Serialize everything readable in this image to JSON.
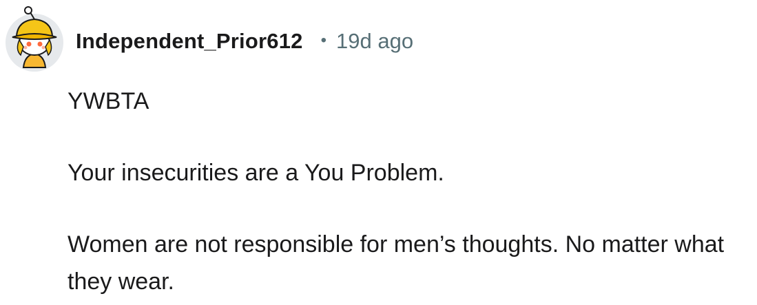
{
  "comment": {
    "avatar_icon": "snoo-avatar-yellow-bucket-hat-icon",
    "username": "Independent_Prior612",
    "separator": "•",
    "timestamp": "19d ago",
    "paragraphs": [
      "YWBTA",
      "Your insecurities are a You Problem.",
      "Women are not responsible for men’s thoughts. No matter what they wear."
    ]
  },
  "colors": {
    "text": "#1a1a1b",
    "meta": "#576f76",
    "avatar_bg": "#e6e9ec",
    "hat": "#f5c518"
  }
}
